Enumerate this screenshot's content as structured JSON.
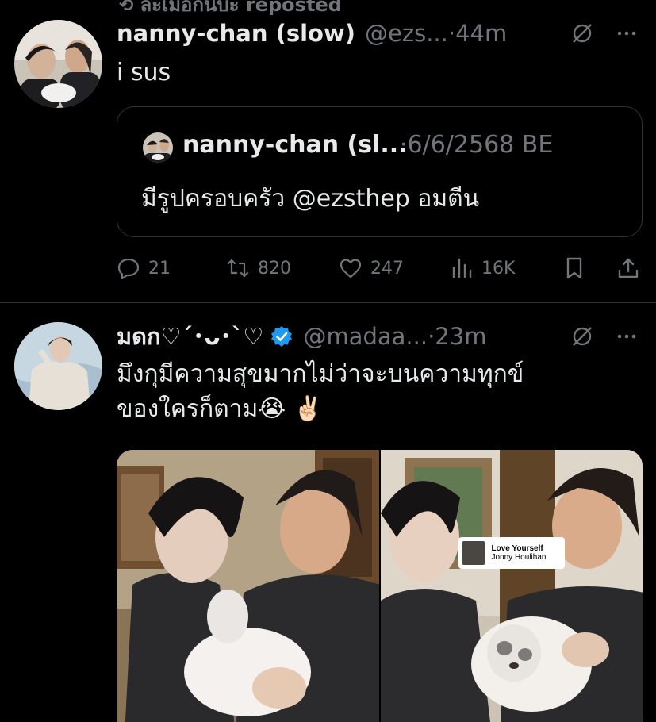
{
  "repost_banner": {
    "label": "ละเมอกินบะ reposted"
  },
  "tweets": [
    {
      "name": "nanny-chan (slow)",
      "handle": "@ezs...",
      "time": "·44m",
      "text": "i sus",
      "quote": {
        "name": "nanny-chan (sl...",
        "date": "·6/6/2568 BE",
        "text": "มีรูปครอบครัว @ezsthep อมตีน"
      },
      "stats": {
        "replies": "21",
        "reposts": "820",
        "likes": "247",
        "views": "16K"
      }
    },
    {
      "name": "มดก♡´･ᴗ･`♡",
      "handle": "@madaa...",
      "time": "·23m",
      "text_lines": [
        "มึงกุมีความสุขมากไม่ว่าจะบนความทุกข์",
        "ของใครก็ตาม😭 ✌🏻"
      ],
      "media_card": {
        "title": "Love Yourself",
        "artist": "Jonny Houlihan"
      }
    }
  ],
  "icons": [
    "repost-icon",
    "grok-icon",
    "more-icon",
    "reply-icon",
    "retweet-icon",
    "like-icon",
    "views-icon",
    "bookmark-icon",
    "share-icon",
    "verified-badge-icon"
  ],
  "colors": {
    "background": "#000000",
    "text": "#e7e9ea",
    "muted": "#71767b",
    "border": "#2f3336",
    "verified": "#1d9bf0"
  }
}
